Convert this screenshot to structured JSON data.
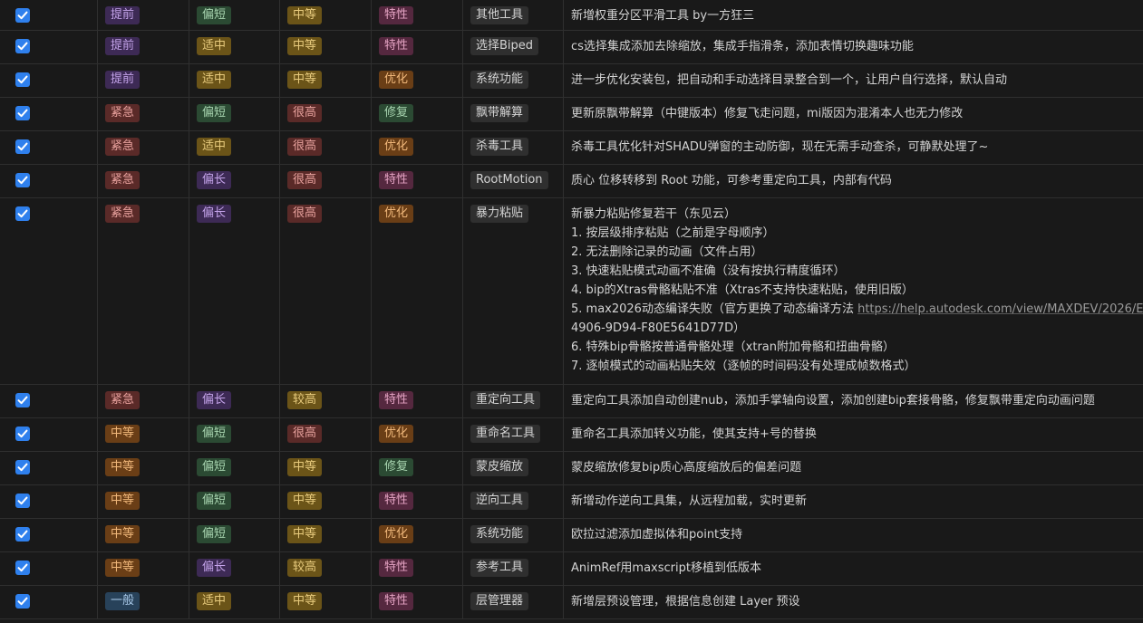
{
  "colors": {
    "background": "#191919",
    "checkbox": "#2f80ed",
    "tag_brown": "#4a3520",
    "tag_purple": "#3d2a55",
    "tag_red": "#5a2a28",
    "tag_blue": "#28425a",
    "tag_green": "#2b4a33",
    "tag_yellow": "#6b5418",
    "tag_orange": "#6a3e16",
    "tag_pink": "#55283f"
  },
  "rows": [
    {
      "done": true,
      "priority": "提前",
      "priority_color": "purple",
      "duration": "偏短",
      "duration_color": "green",
      "difficulty": "中等",
      "difficulty_color": "yellow",
      "type": "特性",
      "type_color": "pink",
      "module": "其他工具",
      "desc": [
        "新增权重分区平滑工具 by一方狂三"
      ]
    },
    {
      "done": true,
      "priority": "提前",
      "priority_color": "purple",
      "duration": "适中",
      "duration_color": "yellow",
      "difficulty": "中等",
      "difficulty_color": "yellow",
      "type": "特性",
      "type_color": "pink",
      "module": "选择Biped",
      "desc": [
        "cs选择集成添加去除缩放，集成手指滑条，添加表情切换趣味功能"
      ]
    },
    {
      "done": true,
      "priority": "提前",
      "priority_color": "purple",
      "duration": "适中",
      "duration_color": "yellow",
      "difficulty": "中等",
      "difficulty_color": "yellow",
      "type": "优化",
      "type_color": "orange",
      "module": "系统功能",
      "desc": [
        "进一步优化安装包，把自动和手动选择目录整合到一个，让用户自行选择，默认自动"
      ]
    },
    {
      "done": true,
      "priority": "紧急",
      "priority_color": "red",
      "duration": "偏短",
      "duration_color": "green",
      "difficulty": "很高",
      "difficulty_color": "red",
      "type": "修复",
      "type_color": "green",
      "module": "飘带解算",
      "desc": [
        "更新原飘带解算（中键版本）修复飞走问题，mi版因为混淆本人也无力修改"
      ]
    },
    {
      "done": true,
      "priority": "紧急",
      "priority_color": "red",
      "duration": "适中",
      "duration_color": "yellow",
      "difficulty": "很高",
      "difficulty_color": "red",
      "type": "优化",
      "type_color": "orange",
      "module": "杀毒工具",
      "desc": [
        "杀毒工具优化针对SHADU弹窗的主动防御，现在无需手动查杀，可静默处理了~"
      ]
    },
    {
      "done": true,
      "priority": "紧急",
      "priority_color": "red",
      "duration": "偏长",
      "duration_color": "purple",
      "difficulty": "很高",
      "difficulty_color": "red",
      "type": "特性",
      "type_color": "pink",
      "module": "RootMotion",
      "desc": [
        "质心 位移转移到 Root 功能，可参考重定向工具，内部有代码"
      ]
    },
    {
      "done": true,
      "priority": "紧急",
      "priority_color": "red",
      "duration": "偏长",
      "duration_color": "purple",
      "difficulty": "很高",
      "difficulty_color": "red",
      "type": "优化",
      "type_color": "orange",
      "module": "暴力粘贴",
      "desc": [
        "新暴力粘贴修复若干（东见云）",
        "1. 按层级排序粘贴（之前是字母顺序）",
        "2. 无法删除记录的动画（文件占用）",
        "3. 快速粘贴模式动画不准确（没有按执行精度循环）",
        "4. bip的Xtras骨骼粘贴不准（Xtras不支持快速粘贴，使用旧版）",
        "5. max2026动态编译失败（官方更换了动态编译方法 ",
        "4906-9D94-F80E5641D77D）",
        "6. 特殊bip骨骼按普通骨骼处理（xtran附加骨骼和扭曲骨骼）",
        "7. 逐帧模式的动画粘贴失效（逐帧的时间码没有处理成帧数格式）"
      ],
      "link": "https://help.autodesk.com/view/MAXDEV/2026/E"
    },
    {
      "done": true,
      "priority": "紧急",
      "priority_color": "red",
      "duration": "偏长",
      "duration_color": "purple",
      "difficulty": "较高",
      "difficulty_color": "yellow",
      "type": "特性",
      "type_color": "pink",
      "module": "重定向工具",
      "desc": [
        "重定向工具添加自动创建nub，添加手掌轴向设置，添加创建bip套接骨骼，修复飘带重定向动画问题"
      ]
    },
    {
      "done": true,
      "priority": "中等",
      "priority_color": "orange",
      "duration": "偏短",
      "duration_color": "green",
      "difficulty": "很高",
      "difficulty_color": "red",
      "type": "优化",
      "type_color": "orange",
      "module": "重命名工具",
      "desc": [
        "重命名工具添加转义功能，使其支持+号的替换"
      ]
    },
    {
      "done": true,
      "priority": "中等",
      "priority_color": "orange",
      "duration": "偏短",
      "duration_color": "green",
      "difficulty": "中等",
      "difficulty_color": "yellow",
      "type": "修复",
      "type_color": "green",
      "module": "蒙皮缩放",
      "desc": [
        "蒙皮缩放修复bip质心高度缩放后的偏差问题"
      ]
    },
    {
      "done": true,
      "priority": "中等",
      "priority_color": "orange",
      "duration": "偏短",
      "duration_color": "green",
      "difficulty": "中等",
      "difficulty_color": "yellow",
      "type": "特性",
      "type_color": "pink",
      "module": "逆向工具",
      "desc": [
        "新增动作逆向工具集，从远程加载，实时更新"
      ]
    },
    {
      "done": true,
      "priority": "中等",
      "priority_color": "orange",
      "duration": "偏短",
      "duration_color": "green",
      "difficulty": "中等",
      "difficulty_color": "yellow",
      "type": "优化",
      "type_color": "orange",
      "module": "系统功能",
      "desc": [
        "欧拉过滤添加虚拟体和point支持"
      ]
    },
    {
      "done": true,
      "priority": "中等",
      "priority_color": "orange",
      "duration": "偏长",
      "duration_color": "purple",
      "difficulty": "较高",
      "difficulty_color": "yellow",
      "type": "特性",
      "type_color": "pink",
      "module": "参考工具",
      "desc": [
        "AnimRef用maxscript移植到低版本"
      ]
    },
    {
      "done": true,
      "priority": "一般",
      "priority_color": "blue",
      "duration": "适中",
      "duration_color": "yellow",
      "difficulty": "中等",
      "difficulty_color": "yellow",
      "type": "特性",
      "type_color": "pink",
      "module": "层管理器",
      "desc": [
        "新增层预设管理，根据信息创建 Layer 预设"
      ]
    }
  ]
}
